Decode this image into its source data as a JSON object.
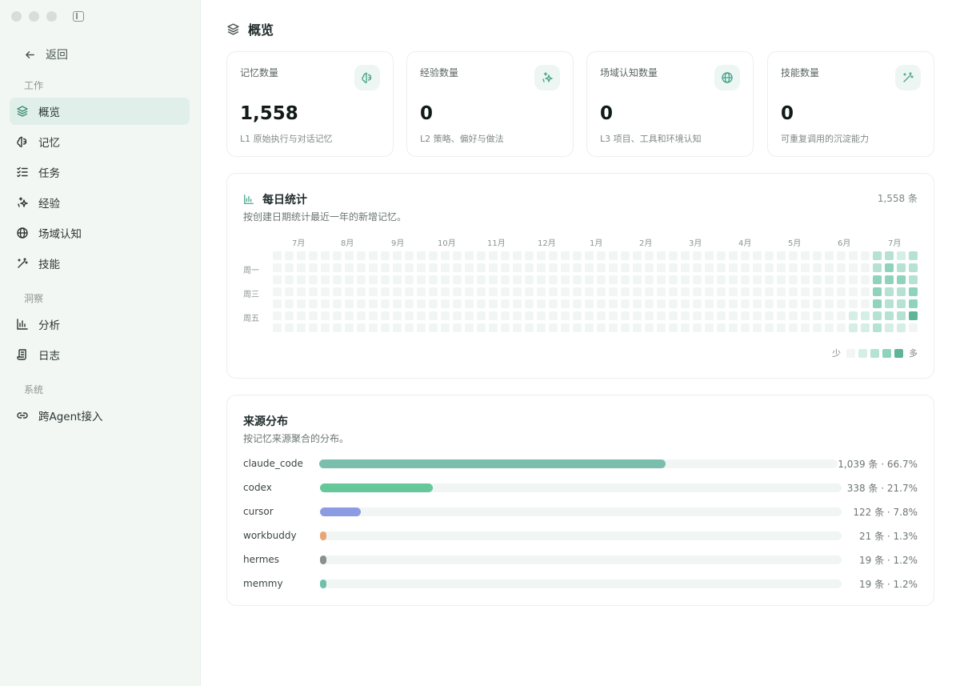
{
  "sidebar": {
    "back_label": "返回",
    "sections": [
      {
        "label": "工作"
      },
      {
        "label": "洞察"
      },
      {
        "label": "系统"
      }
    ],
    "items": [
      {
        "label": "概览",
        "icon": "layers-icon",
        "active": true
      },
      {
        "label": "记忆",
        "icon": "brain-icon"
      },
      {
        "label": "任务",
        "icon": "checklist-icon"
      },
      {
        "label": "经验",
        "icon": "sparkles-icon"
      },
      {
        "label": "场域认知",
        "icon": "globe-icon"
      },
      {
        "label": "技能",
        "icon": "magic-wand-icon"
      },
      {
        "label": "分析",
        "icon": "bar-chart-icon"
      },
      {
        "label": "日志",
        "icon": "scroll-icon"
      },
      {
        "label": "跨Agent接入",
        "icon": "link-icon"
      }
    ]
  },
  "page": {
    "title": "概览"
  },
  "stats": [
    {
      "label": "记忆数量",
      "value": "1,558",
      "desc": "L1 原始执行与对话记忆",
      "icon": "brain-icon"
    },
    {
      "label": "经验数量",
      "value": "0",
      "desc": "L2 策略、偏好与做法",
      "icon": "sparkles-icon"
    },
    {
      "label": "场域认知数量",
      "value": "0",
      "desc": "L3 项目、工具和环境认知",
      "icon": "globe-icon"
    },
    {
      "label": "技能数量",
      "value": "0",
      "desc": "可重复调用的沉淀能力",
      "icon": "magic-wand-icon"
    }
  ],
  "daily": {
    "title": "每日统计",
    "subtitle": "按创建日期统计最近一年的新增记忆。",
    "total": "1,558 条",
    "months": [
      "7月",
      "8月",
      "9月",
      "10月",
      "11月",
      "12月",
      "1月",
      "2月",
      "3月",
      "4月",
      "5月",
      "6月",
      "7月"
    ],
    "weekdays": [
      "周一",
      "周三",
      "周五"
    ],
    "legend_less": "少",
    "legend_more": "多",
    "levels": [
      "#f1f6f4",
      "#d6efe6",
      "#b5e2d3",
      "#8fd3bc",
      "#5eb596"
    ],
    "recent_weeks": [
      [
        0,
        0,
        0,
        0,
        0,
        1,
        1
      ],
      [
        0,
        0,
        0,
        0,
        0,
        1,
        1
      ],
      [
        2,
        2,
        3,
        3,
        3,
        2,
        2
      ],
      [
        2,
        3,
        3,
        2,
        2,
        2,
        1
      ],
      [
        1,
        2,
        3,
        2,
        2,
        2,
        1
      ],
      [
        2,
        2,
        2,
        3,
        3,
        4,
        0
      ]
    ]
  },
  "source": {
    "title": "来源分布",
    "subtitle": "按记忆来源聚合的分布。",
    "rows": [
      {
        "name": "claude_code",
        "text": "1,039 条 · 66.7%",
        "fraction": 0.667,
        "color": "#7abfae"
      },
      {
        "name": "codex",
        "text": "338 条 · 21.7%",
        "fraction": 0.217,
        "color": "#66c79a"
      },
      {
        "name": "cursor",
        "text": "122 条 · 7.8%",
        "fraction": 0.078,
        "color": "#8c9ce3"
      },
      {
        "name": "workbuddy",
        "text": "21 条 · 1.3%",
        "fraction": 0.013,
        "color": "#e8a674"
      },
      {
        "name": "hermes",
        "text": "19 条 · 1.2%",
        "fraction": 0.012,
        "color": "#8a908e"
      },
      {
        "name": "memmy",
        "text": "19 条 · 1.2%",
        "fraction": 0.012,
        "color": "#6fbfa9"
      }
    ]
  }
}
